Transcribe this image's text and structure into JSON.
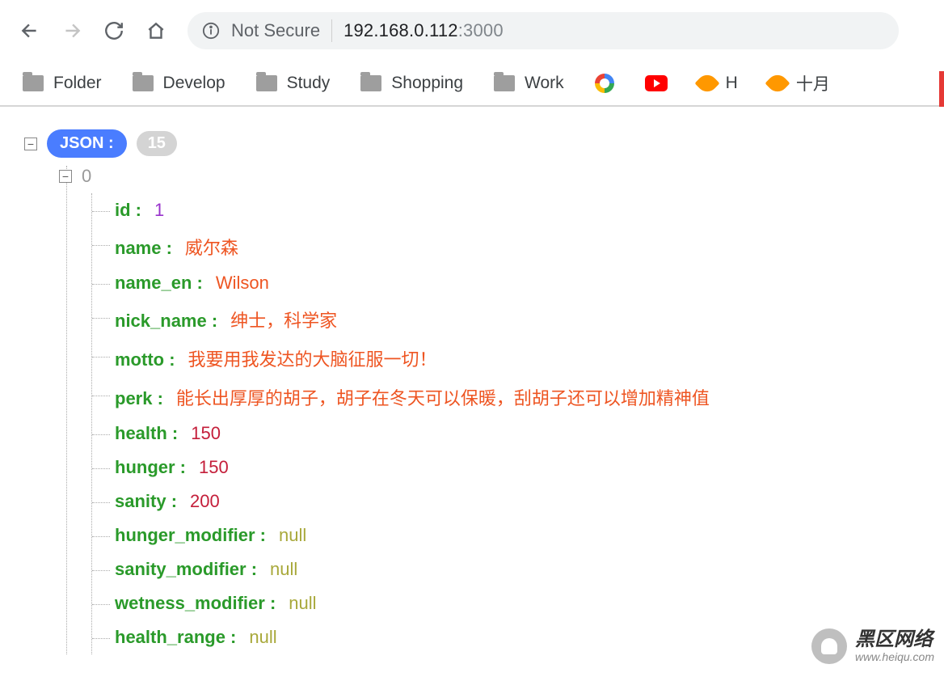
{
  "toolbar": {
    "not_secure_label": "Not Secure",
    "url_host": "192.168.0.112",
    "url_port": ":3000"
  },
  "bookmarks": [
    {
      "label": "Folder",
      "type": "folder"
    },
    {
      "label": "Develop",
      "type": "folder"
    },
    {
      "label": "Study",
      "type": "folder"
    },
    {
      "label": "Shopping",
      "type": "folder"
    },
    {
      "label": "Work",
      "type": "folder"
    },
    {
      "label": "",
      "type": "google"
    },
    {
      "label": "",
      "type": "youtube"
    },
    {
      "label": "H",
      "type": "leaf"
    },
    {
      "label": "十月",
      "type": "leaf"
    }
  ],
  "json_view": {
    "root_label": "JSON :",
    "count": "15",
    "index": "0",
    "fields": [
      {
        "key": "id :",
        "value": "1",
        "vtype": "purple"
      },
      {
        "key": "name :",
        "value": "威尔森",
        "vtype": "str"
      },
      {
        "key": "name_en :",
        "value": "Wilson",
        "vtype": "str"
      },
      {
        "key": "nick_name :",
        "value": "绅士，科学家",
        "vtype": "str"
      },
      {
        "key": "motto :",
        "value": "我要用我发达的大脑征服一切！",
        "vtype": "str"
      },
      {
        "key": "perk :",
        "value": "能长出厚厚的胡子，胡子在冬天可以保暖，刮胡子还可以增加精神值",
        "vtype": "str"
      },
      {
        "key": "health :",
        "value": "150",
        "vtype": "num"
      },
      {
        "key": "hunger :",
        "value": "150",
        "vtype": "num"
      },
      {
        "key": "sanity :",
        "value": "200",
        "vtype": "num"
      },
      {
        "key": "hunger_modifier :",
        "value": "null",
        "vtype": "null"
      },
      {
        "key": "sanity_modifier :",
        "value": "null",
        "vtype": "null"
      },
      {
        "key": "wetness_modifier :",
        "value": "null",
        "vtype": "null"
      },
      {
        "key": "health_range :",
        "value": "null",
        "vtype": "null"
      }
    ]
  },
  "watermark": {
    "title": "黑区网络",
    "url": "www.heiqu.com"
  }
}
